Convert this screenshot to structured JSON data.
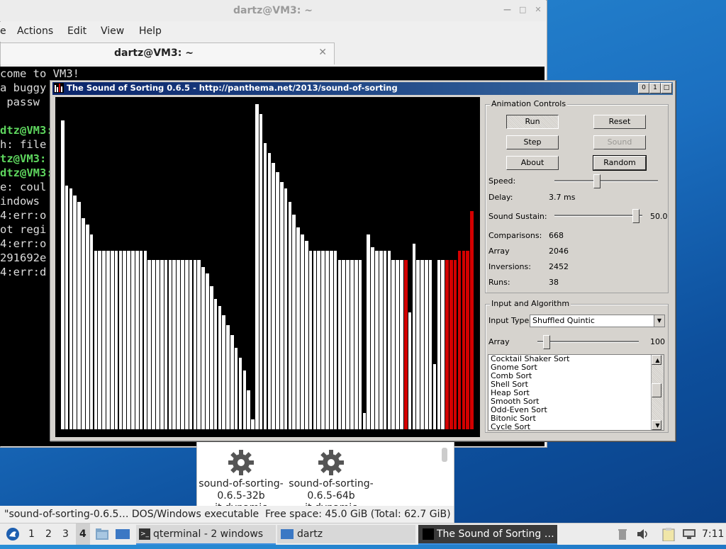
{
  "terminal": {
    "window_title": "dartz@VM3: ~",
    "menu": [
      "e",
      "Actions",
      "Edit",
      "View",
      "Help"
    ],
    "tab_title": "dartz@VM3: ~",
    "lines": [
      {
        "text": "come to VM3!",
        "green": false
      },
      {
        "text": "a buggy",
        "green": false
      },
      {
        "text": " passw",
        "green": false
      },
      {
        "text": "",
        "green": false
      },
      {
        "text": "dtz@VM3:",
        "green": true
      },
      {
        "text": "h: file",
        "green": false
      },
      {
        "text": "tz@VM3:",
        "green": true
      },
      {
        "text": "dtz@VM3:",
        "green": true
      },
      {
        "text": "e: coul",
        "green": false
      },
      {
        "text": "indows",
        "green": false
      },
      {
        "text": "4:err:o",
        "green": false
      },
      {
        "text": "ot regi",
        "green": false
      },
      {
        "text": "4:err:o",
        "green": false
      },
      {
        "text": "291692e",
        "green": false
      },
      {
        "text": "4:err:d",
        "green": false
      }
    ]
  },
  "file_manager": {
    "items": [
      {
        "name": "sound-of-sorting-0.6.5-32b",
        "sub": "it dynamic"
      },
      {
        "name": "sound-of-sorting-0.6.5-64b",
        "sub": "it dynamic"
      }
    ],
    "status_left": "\"sound-of-sorting-0.6.5… DOS/Windows executable",
    "status_right": "Free space: 45.0 GiB (Total: 62.7 GiB)"
  },
  "sorting": {
    "title": "The Sound of Sorting 0.6.5 - http://panthema.net/2013/sound-of-sorting",
    "title_buttons": [
      "0",
      "1",
      "□"
    ],
    "animation_controls": {
      "label": "Animation Controls",
      "run": "Run",
      "reset": "Reset",
      "step": "Step",
      "sound": "Sound",
      "about": "About",
      "random": "Random",
      "speed_label": "Speed:",
      "speed_level": 0.4,
      "delay_label": "Delay:",
      "delay_value": "3.7 ms",
      "sustain_label": "Sound Sustain:",
      "sustain_value": "50.0",
      "sustain_level": 0.95,
      "comparisons_label": "Comparisons:",
      "comparisons": "668",
      "array_label": "Array",
      "array_value": "2046",
      "inversions_label": "Inversions:",
      "inversions": "2452",
      "runs_label": "Runs:",
      "runs": "38"
    },
    "input": {
      "label": "Input and Algorithm",
      "type_label": "Input Type:",
      "type_value": "Shuffled Quintic",
      "array_label": "Array",
      "array_value": "100",
      "array_level": 0.06,
      "algorithms": [
        "Cocktail Shaker Sort",
        "Gnome Sort",
        "Comb Sort",
        "Shell Sort",
        "Heap Sort",
        "Smooth Sort",
        "Odd-Even Sort",
        "Bitonic Sort",
        "Cycle Sort"
      ]
    },
    "bars": [
      0.95,
      0.75,
      0.74,
      0.72,
      0.7,
      0.65,
      0.63,
      0.6,
      0.55,
      0.55,
      0.55,
      0.55,
      0.55,
      0.55,
      0.55,
      0.55,
      0.55,
      0.55,
      0.55,
      0.55,
      0.55,
      0.52,
      0.52,
      0.52,
      0.52,
      0.52,
      0.52,
      0.52,
      0.52,
      0.52,
      0.52,
      0.52,
      0.52,
      0.52,
      0.5,
      0.48,
      0.44,
      0.4,
      0.38,
      0.35,
      0.32,
      0.29,
      0.25,
      0.22,
      0.18,
      0.12,
      0.03,
      1.0,
      0.97,
      0.88,
      0.85,
      0.82,
      0.79,
      0.76,
      0.74,
      0.7,
      0.66,
      0.62,
      0.6,
      0.58,
      0.55,
      0.55,
      0.55,
      0.55,
      0.55,
      0.55,
      0.55,
      0.52,
      0.52,
      0.52,
      0.52,
      0.52,
      0.52,
      0.05,
      0.6,
      0.56,
      0.55,
      0.55,
      0.55,
      0.55,
      0.52,
      0.52,
      0.52,
      0.52,
      0.36,
      0.57,
      0.52,
      0.52,
      0.52,
      0.52,
      0.2,
      0.52,
      0.52,
      0.52,
      0.52,
      0.52,
      0.55,
      0.55,
      0.55,
      0.67
    ],
    "red_bars": [
      84,
      94,
      95,
      96,
      97,
      98,
      99,
      100
    ]
  },
  "taskbar": {
    "workspaces": [
      "1",
      "2",
      "3",
      "4"
    ],
    "tasks": [
      "qterminal - 2 windows",
      "dartz",
      "The Sound of Sorting …"
    ],
    "clock": "7:11"
  },
  "colors": {
    "bar": "#ffffff",
    "bar_highlight": "#d40000",
    "title_bar": "#0a246a"
  }
}
